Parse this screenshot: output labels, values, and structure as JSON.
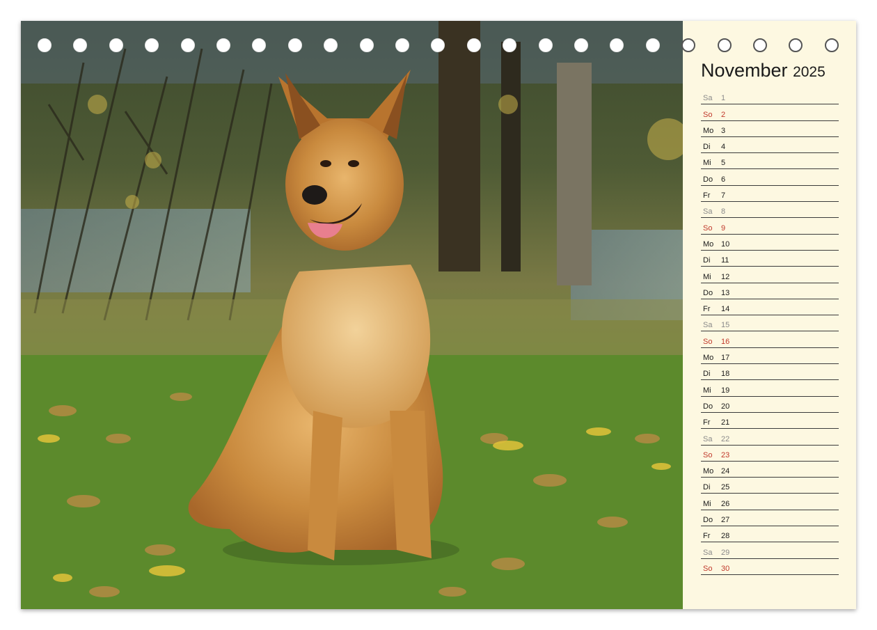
{
  "calendar": {
    "month": "November",
    "year": "2025",
    "days": [
      {
        "name": "Sa",
        "num": "1",
        "kind": "sat"
      },
      {
        "name": "So",
        "num": "2",
        "kind": "sun"
      },
      {
        "name": "Mo",
        "num": "3",
        "kind": "week"
      },
      {
        "name": "Di",
        "num": "4",
        "kind": "week"
      },
      {
        "name": "Mi",
        "num": "5",
        "kind": "week"
      },
      {
        "name": "Do",
        "num": "6",
        "kind": "week"
      },
      {
        "name": "Fr",
        "num": "7",
        "kind": "week"
      },
      {
        "name": "Sa",
        "num": "8",
        "kind": "sat"
      },
      {
        "name": "So",
        "num": "9",
        "kind": "sun"
      },
      {
        "name": "Mo",
        "num": "10",
        "kind": "week"
      },
      {
        "name": "Di",
        "num": "11",
        "kind": "week"
      },
      {
        "name": "Mi",
        "num": "12",
        "kind": "week"
      },
      {
        "name": "Do",
        "num": "13",
        "kind": "week"
      },
      {
        "name": "Fr",
        "num": "14",
        "kind": "week"
      },
      {
        "name": "Sa",
        "num": "15",
        "kind": "sat"
      },
      {
        "name": "So",
        "num": "16",
        "kind": "sun"
      },
      {
        "name": "Mo",
        "num": "17",
        "kind": "week"
      },
      {
        "name": "Di",
        "num": "18",
        "kind": "week"
      },
      {
        "name": "Mi",
        "num": "19",
        "kind": "week"
      },
      {
        "name": "Do",
        "num": "20",
        "kind": "week"
      },
      {
        "name": "Fr",
        "num": "21",
        "kind": "week"
      },
      {
        "name": "Sa",
        "num": "22",
        "kind": "sat"
      },
      {
        "name": "So",
        "num": "23",
        "kind": "sun"
      },
      {
        "name": "Mo",
        "num": "24",
        "kind": "week"
      },
      {
        "name": "Di",
        "num": "25",
        "kind": "week"
      },
      {
        "name": "Mi",
        "num": "26",
        "kind": "week"
      },
      {
        "name": "Do",
        "num": "27",
        "kind": "week"
      },
      {
        "name": "Fr",
        "num": "28",
        "kind": "week"
      },
      {
        "name": "Sa",
        "num": "29",
        "kind": "sat"
      },
      {
        "name": "So",
        "num": "30",
        "kind": "sun"
      }
    ]
  },
  "photo": {
    "subject": "dog-photo"
  },
  "binding": {
    "hole_count": 23
  }
}
